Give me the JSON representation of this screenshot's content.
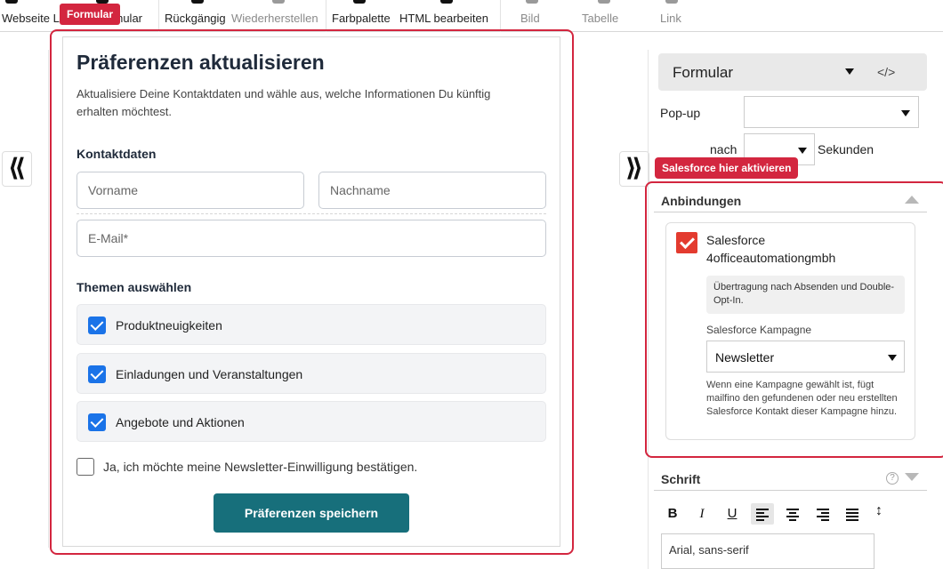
{
  "toolbar": {
    "items": [
      {
        "label": "Webseite L",
        "disabled": false
      },
      {
        "label": "Formular",
        "disabled": false
      },
      {
        "label": "Rückgängig",
        "disabled": false
      },
      {
        "label": "Wiederherstellen",
        "disabled": true
      },
      {
        "label": "Farbpalette",
        "disabled": false
      },
      {
        "label": "HTML bearbeiten",
        "disabled": false
      },
      {
        "label": "Bild",
        "disabled": true
      },
      {
        "label": "Tabelle",
        "disabled": true
      },
      {
        "label": "Link",
        "disabled": true
      }
    ]
  },
  "form": {
    "tag": "Formular",
    "title": "Präferenzen aktualisieren",
    "intro": "Aktualisiere Deine Kontaktdaten und wähle aus, welche Informationen Du künftig erhalten möchtest.",
    "contact_heading": "Kontaktdaten",
    "first_name_placeholder": "Vorname",
    "last_name_placeholder": "Nachname",
    "email_placeholder": "E-Mail*",
    "topics_heading": "Themen auswählen",
    "topics": [
      {
        "label": "Produktneuigkeiten",
        "checked": true
      },
      {
        "label": "Einladungen und Veranstaltungen",
        "checked": true
      },
      {
        "label": "Angebote und Aktionen",
        "checked": true
      }
    ],
    "newsletter_consent": "Ja, ich möchte meine Newsletter-Einwilligung bestätigen.",
    "newsletter_checked": false,
    "submit_label": "Präferenzen speichern"
  },
  "nav": {
    "collapse_left": "⟪",
    "expand_right": "⟫"
  },
  "panel": {
    "header_title": "Formular",
    "code_icon": "</>",
    "popup_label": "Pop-up",
    "popup_value": "",
    "after_label": "nach",
    "after_value": "",
    "seconds_label": "Sekunden",
    "salesforce_tag": "Salesforce hier aktivieren",
    "connections_title": "Anbindungen",
    "salesforce_name": "Salesforce",
    "salesforce_account": "4officeautomationgmbh",
    "salesforce_enabled": true,
    "transfer_note": "Übertragung nach Absenden und Double-Opt-In.",
    "campaign_label": "Salesforce Kampagne",
    "campaign_value": "Newsletter",
    "campaign_help": "Wenn eine Kampagne gewählt ist, fügt mailfino den gefundenen oder neu erstellten Salesforce Kontakt dieser Kampagne hinzu.",
    "font_title": "Schrift",
    "help_icon": "?",
    "font_family_value": "Arial, sans-serif",
    "format_buttons": {
      "bold": "B",
      "italic": "I",
      "underline": "U"
    }
  },
  "colors": {
    "highlight_red": "#d3263f",
    "submit_teal": "#176f7b",
    "checkbox_blue": "#1a73e8",
    "salesforce_check": "#e33b2f"
  }
}
